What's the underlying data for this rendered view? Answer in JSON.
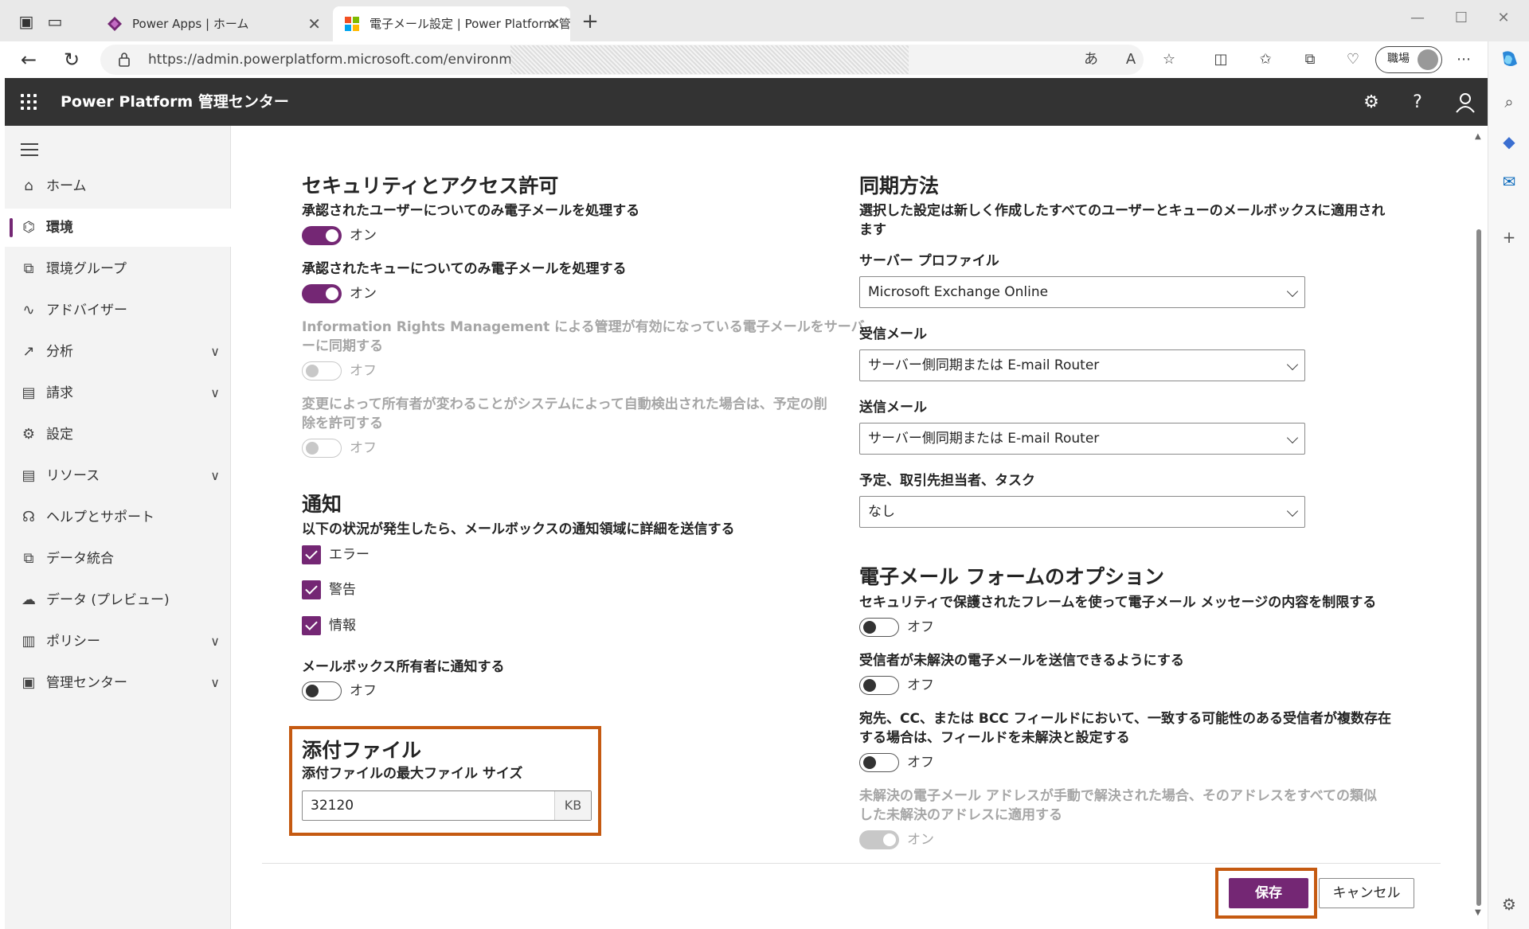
{
  "browser": {
    "tabs": [
      {
        "title": "Power Apps | ホーム"
      },
      {
        "title": "電子メール設定 | Power Platform 管"
      }
    ],
    "url": "https://admin.powerplatform.microsoft.com/environments/",
    "profile_label": "職場"
  },
  "header": {
    "app_title": "Power Platform 管理センター"
  },
  "nav": {
    "items": [
      {
        "label": "ホーム"
      },
      {
        "label": "環境"
      },
      {
        "label": "環境グループ"
      },
      {
        "label": "アドバイザー"
      },
      {
        "label": "分析"
      },
      {
        "label": "請求"
      },
      {
        "label": "設定"
      },
      {
        "label": "リソース"
      },
      {
        "label": "ヘルプとサポート"
      },
      {
        "label": "データ統合"
      },
      {
        "label": "データ (プレビュー)"
      },
      {
        "label": "ポリシー"
      },
      {
        "label": "管理センター"
      }
    ]
  },
  "security": {
    "title": "セキュリティとアクセス許可",
    "items": [
      {
        "label": "承認されたユーザーについてのみ電子メールを処理する",
        "state": "オン"
      },
      {
        "label": "承認されたキューについてのみ電子メールを処理する",
        "state": "オン"
      },
      {
        "label_1": "Information Rights Management による管理が有効になっている電子メールをサーバ",
        "label_2": "ーに同期する",
        "state": "オフ"
      },
      {
        "label_1": "変更によって所有者が変わることがシステムによって自動検出された場合は、予定の削",
        "label_2": "除を許可する",
        "state": "オフ"
      }
    ]
  },
  "notify": {
    "title": "通知",
    "desc": "以下の状況が発生したら、メールボックスの通知領域に詳細を送信する",
    "checks": [
      {
        "label": "エラー"
      },
      {
        "label": "警告"
      },
      {
        "label": "情報"
      }
    ],
    "owner_label": "メールボックス所有者に通知する",
    "owner_state": "オフ"
  },
  "attach": {
    "title": "添付ファイル",
    "label": "添付ファイルの最大ファイル サイズ",
    "value": "32120",
    "unit": "KB"
  },
  "sync": {
    "title": "同期方法",
    "desc_1": "選択した設定は新しく作成したすべてのユーザーとキューのメールボックスに適用され",
    "desc_2": "ます",
    "fields": [
      {
        "label": "サーバー プロファイル",
        "value": "Microsoft Exchange Online"
      },
      {
        "label": "受信メール",
        "value": "サーバー側同期または E-mail Router"
      },
      {
        "label": "送信メール",
        "value": "サーバー側同期または E-mail Router"
      },
      {
        "label": "予定、取引先担当者、タスク",
        "value": "なし"
      }
    ]
  },
  "formopt": {
    "title": "電子メール フォームのオプション",
    "items": [
      {
        "label_1": "セキュリティで保護されたフレームを使って電子メール メッセージの内容を制限する",
        "label_2": "",
        "state": "オフ"
      },
      {
        "label_1": "受信者が未解決の電子メールを送信できるようにする",
        "label_2": "",
        "state": "オフ"
      },
      {
        "label_1": "宛先、CC、または BCC フィールドにおいて、一致する可能性のある受信者が複数存在",
        "label_2": "する場合は、フィールドを未解決と設定する",
        "state": "オフ"
      },
      {
        "label_1": "未解決の電子メール アドレスが手動で解決された場合、そのアドレスをすべての類似",
        "label_2": "した未解決のアドレスに適用する",
        "state": "オン"
      }
    ]
  },
  "actions": {
    "save": "保存",
    "cancel": "キャンセル"
  },
  "colors": {
    "accent": "#742774",
    "header_bg": "#333333",
    "highlight": "#c55a11"
  }
}
